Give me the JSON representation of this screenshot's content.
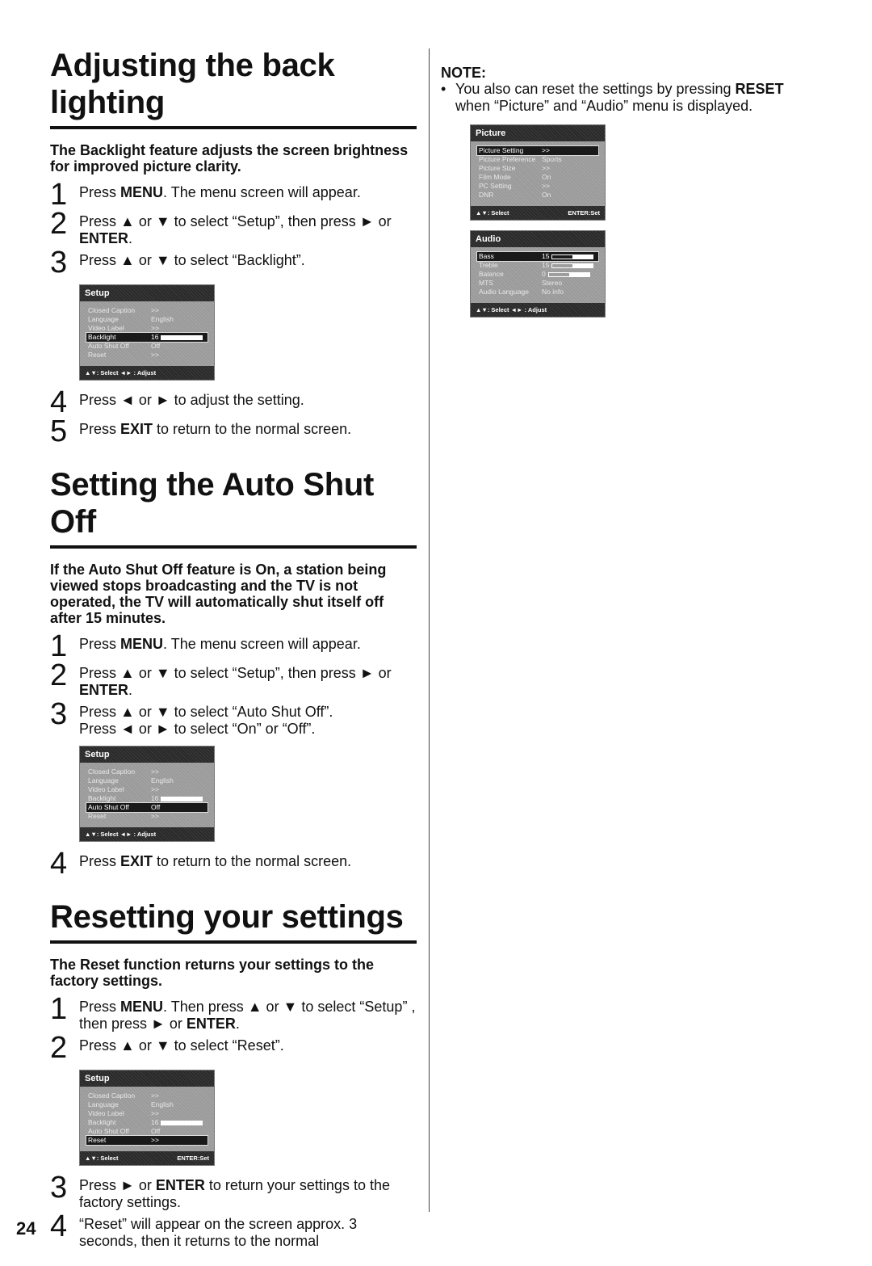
{
  "page_number": "24",
  "sections": [
    {
      "title": "Adjusting the back lighting",
      "lead": "The Backlight feature adjusts the screen brightness for improved picture clarity.",
      "steps_before": [
        {
          "num": "1",
          "html": "Press <b>MENU</b>. The menu screen will appear."
        },
        {
          "num": "2",
          "html": "Press ▲ or ▼ to select “Setup”, then press ► or <b>ENTER</b>."
        },
        {
          "num": "3",
          "html": "Press ▲ or ▼ to select “Backlight”."
        }
      ],
      "osd": {
        "title": "Setup",
        "rows": [
          {
            "label": "Closed Caption",
            "value": ">>"
          },
          {
            "label": "Language",
            "value": "English"
          },
          {
            "label": "Video Label",
            "value": ">>"
          },
          {
            "label": "Backlight",
            "value": "16",
            "bar": "full",
            "selected": true
          },
          {
            "label": "Auto Shut Off",
            "value": "Off"
          },
          {
            "label": "Reset",
            "value": ">>"
          }
        ],
        "footer_left": "▲▼: Select   ◄► : Adjust",
        "footer_right": ""
      },
      "steps_after": [
        {
          "num": "4",
          "html": "Press ◄ or ► to adjust the setting."
        },
        {
          "num": "5",
          "html": "Press <b>EXIT</b> to return to the normal screen."
        }
      ]
    },
    {
      "title": "Setting the Auto Shut Off",
      "lead": "If the Auto Shut Off feature is On, a station being viewed stops broadcasting and the TV is not operated, the TV will automatically shut itself off after 15 minutes.",
      "steps_before": [
        {
          "num": "1",
          "html": "Press <b>MENU</b>. The menu screen will appear."
        },
        {
          "num": "2",
          "html": "Press ▲ or ▼ to select “Setup”, then press ► or <b>ENTER</b>."
        },
        {
          "num": "3",
          "html": "Press ▲ or ▼ to select “Auto Shut Off”.<br>Press ◄ or ► to select “On” or “Off”."
        }
      ],
      "osd": {
        "title": "Setup",
        "rows": [
          {
            "label": "Closed Caption",
            "value": ">>"
          },
          {
            "label": "Language",
            "value": "English"
          },
          {
            "label": "Video Label",
            "value": ">>"
          },
          {
            "label": "Backlight",
            "value": "16",
            "bar": "full"
          },
          {
            "label": "Auto Shut Off",
            "value": "Off",
            "selected": true
          },
          {
            "label": "Reset",
            "value": ">>"
          }
        ],
        "footer_left": "▲▼: Select   ◄► : Adjust",
        "footer_right": ""
      },
      "steps_after": [
        {
          "num": "4",
          "html": "Press <b>EXIT</b> to return to the normal screen."
        }
      ]
    },
    {
      "title": "Resetting your settings",
      "lead": "The Reset function returns your settings to the factory settings.",
      "steps_before": [
        {
          "num": "1",
          "html": "Press <b>MENU</b>. Then press ▲ or ▼ to select “Setup” , then press ► or <b>ENTER</b>."
        },
        {
          "num": "2",
          "html": "Press ▲ or ▼ to select “Reset”."
        }
      ],
      "osd": {
        "title": "Setup",
        "rows": [
          {
            "label": "Closed Caption",
            "value": ">>"
          },
          {
            "label": "Language",
            "value": "English"
          },
          {
            "label": "Video Label",
            "value": ">>"
          },
          {
            "label": "Backlight",
            "value": "16",
            "bar": "full"
          },
          {
            "label": "Auto Shut Off",
            "value": "Off"
          },
          {
            "label": "Reset",
            "value": ">>",
            "selected": true
          }
        ],
        "footer_left": "▲▼: Select",
        "footer_right": "ENTER:Set"
      },
      "steps_after": [
        {
          "num": "3",
          "html": "Press ► or <b>ENTER</b> to return your settings to the factory settings."
        },
        {
          "num": "4",
          "html": "“Reset” will appear on the screen approx. 3 seconds, then it returns to the normal"
        }
      ]
    }
  ],
  "note": {
    "title": "NOTE:",
    "items": [
      {
        "html": "You also can reset the settings by pressing <b>RESET</b> when “Picture” and “Audio” menu is displayed."
      }
    ],
    "osds": [
      {
        "title": "Picture",
        "rows": [
          {
            "label": "Picture Setting",
            "value": ">>",
            "selected": true
          },
          {
            "label": "Picture Preference",
            "value": "Sports"
          },
          {
            "label": "Picture Size",
            "value": ">>"
          },
          {
            "label": "Film Mode",
            "value": "On"
          },
          {
            "label": "PC Setting",
            "value": ">>"
          },
          {
            "label": "DNR",
            "value": "On"
          }
        ],
        "footer_left": "▲▼: Select",
        "footer_right": "ENTER:Set"
      },
      {
        "title": "Audio",
        "rows": [
          {
            "label": "Bass",
            "value": "15",
            "bar": "half",
            "selected": true
          },
          {
            "label": "Treble",
            "value": "15",
            "bar": "half"
          },
          {
            "label": "Balance",
            "value": "0",
            "bar": "half"
          },
          {
            "label": "MTS",
            "value": "Stereo"
          },
          {
            "label": "Audio Language",
            "value": "No info"
          }
        ],
        "footer_left": "▲▼: Select   ◄► : Adjust",
        "footer_right": ""
      }
    ]
  }
}
